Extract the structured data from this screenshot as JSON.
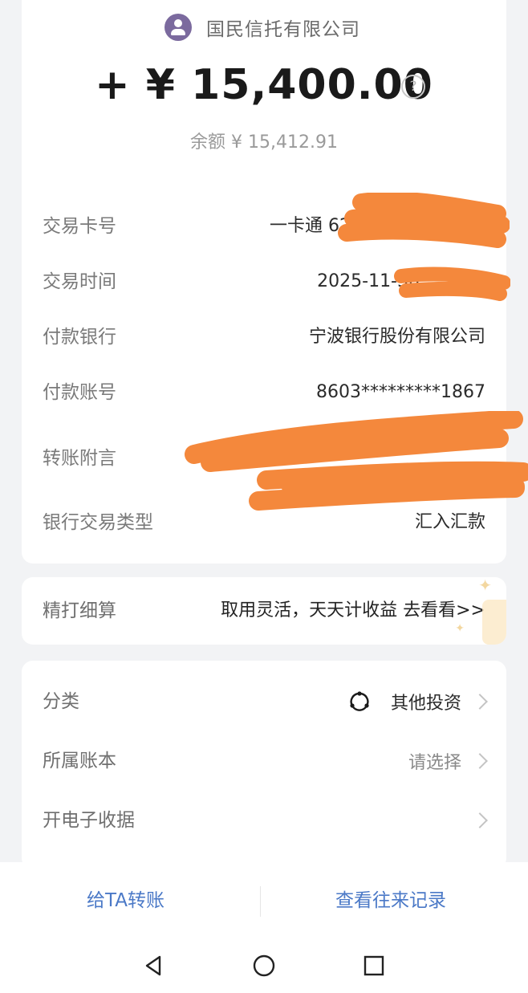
{
  "header": {
    "payer_name": "国民信托有限公司",
    "amount": "+ ¥ 15,400.00",
    "balance": "余额 ¥ 15,412.91"
  },
  "details": [
    {
      "label": "交易卡号",
      "value": "一卡通 62"
    },
    {
      "label": "交易时间",
      "value": "2025-11-30"
    },
    {
      "label": "付款银行",
      "value": "宁波银行股份有限公司"
    },
    {
      "label": "付款账号",
      "value": "8603*********1867"
    },
    {
      "label": "转账附言",
      "value": ""
    },
    {
      "label": "银行交易类型",
      "value": "汇入汇款"
    }
  ],
  "promo": {
    "label": "精打细算",
    "text": "取用灵活，天天计收益 去看看>>"
  },
  "settings": [
    {
      "label": "分类",
      "value": "其他投资",
      "icon": "category-icon"
    },
    {
      "label": "所属账本",
      "value": "请选择"
    },
    {
      "label": "开电子收据",
      "value": ""
    }
  ],
  "actions": {
    "transfer": "给TA转账",
    "history": "查看往来记录"
  },
  "colors": {
    "redaction": "#f4883c",
    "link": "#4b79c7"
  }
}
